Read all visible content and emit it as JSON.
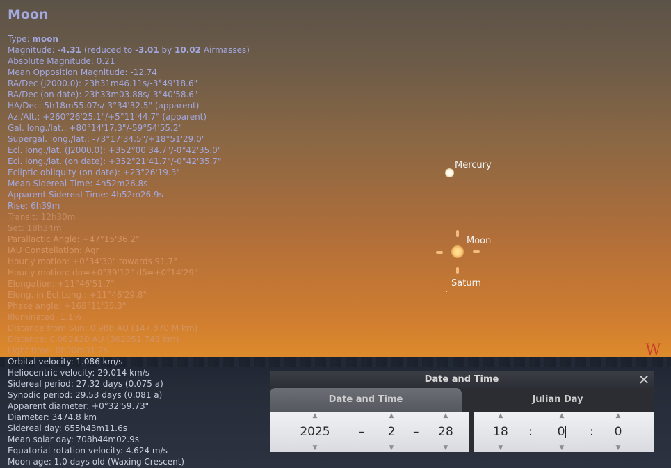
{
  "object": {
    "title": "Moon",
    "lines": [
      {
        "parts": [
          {
            "t": "Type: "
          },
          {
            "t": "moon",
            "b": true
          }
        ],
        "tone": "normal"
      },
      {
        "parts": [
          {
            "t": "Magnitude: "
          },
          {
            "t": "-4.31",
            "b": true
          },
          {
            "t": " (reduced to "
          },
          {
            "t": "-3.01",
            "b": true
          },
          {
            "t": " by "
          },
          {
            "t": "10.02",
            "b": true
          },
          {
            "t": " Airmasses)"
          }
        ],
        "tone": "normal"
      },
      {
        "parts": [
          {
            "t": "Absolute Magnitude: 0.21"
          }
        ],
        "tone": "normal"
      },
      {
        "parts": [
          {
            "t": "Mean Opposition Magnitude: -12.74"
          }
        ],
        "tone": "normal"
      },
      {
        "parts": [
          {
            "t": "RA/Dec (J2000.0): 23h31m46.11s/-3°49'18.6\""
          }
        ],
        "tone": "normal"
      },
      {
        "parts": [
          {
            "t": "RA/Dec (on date): 23h33m03.88s/-3°40'58.6\""
          }
        ],
        "tone": "normal"
      },
      {
        "parts": [
          {
            "t": "HA/Dec: 5h18m55.07s/-3°34'32.5\" (apparent)"
          }
        ],
        "tone": "normal"
      },
      {
        "parts": [
          {
            "t": "Az./Alt.: +260°26'25.1\"/+5°11'44.7\" (apparent)"
          }
        ],
        "tone": "normal"
      },
      {
        "parts": [
          {
            "t": "Gal. long./lat.: +80°14'17.3\"/-59°54'55.2\""
          }
        ],
        "tone": "normal"
      },
      {
        "parts": [
          {
            "t": "Supergal. long./lat.: -73°17'34.5\"/+18°51'29.0\""
          }
        ],
        "tone": "normal"
      },
      {
        "parts": [
          {
            "t": "Ecl. long./lat. (J2000.0): +352°00'34.7\"/-0°42'35.0\""
          }
        ],
        "tone": "normal"
      },
      {
        "parts": [
          {
            "t": "Ecl. long./lat. (on date): +352°21'41.7\"/-0°42'35.7\""
          }
        ],
        "tone": "normal"
      },
      {
        "parts": [
          {
            "t": "Ecliptic obliquity (on date): +23°26'19.3\""
          }
        ],
        "tone": "normal"
      },
      {
        "parts": [
          {
            "t": "Mean Sidereal Time: 4h52m26.8s"
          }
        ],
        "tone": "normal"
      },
      {
        "parts": [
          {
            "t": "Apparent Sidereal Time: 4h52m26.9s"
          }
        ],
        "tone": "normal"
      },
      {
        "parts": [
          {
            "t": "Rise: 6h39m"
          }
        ],
        "tone": "normal"
      },
      {
        "parts": [
          {
            "t": "Transit: 12h30m"
          }
        ],
        "tone": "dim"
      },
      {
        "parts": [
          {
            "t": "Set: 18h34m"
          }
        ],
        "tone": "dim"
      },
      {
        "parts": [
          {
            "t": "Parallactic Angle: +47°15'36.2\""
          }
        ],
        "tone": "faint"
      },
      {
        "parts": [
          {
            "t": "IAU Constellation: Aqr"
          }
        ],
        "tone": "faint"
      },
      {
        "parts": [
          {
            "t": "Hourly motion: +0°34'30\" towards 91.7°"
          }
        ],
        "tone": "faint"
      },
      {
        "parts": [
          {
            "t": "Hourly motion: dα=+0°39'12\" dδ=+0°14'29\""
          }
        ],
        "tone": "faint"
      },
      {
        "parts": [
          {
            "t": "Elongation: +11°46'51.7\""
          }
        ],
        "tone": "faint"
      },
      {
        "parts": [
          {
            "t": "Elong. in Ecl.Long.: +11°46'29.8\""
          }
        ],
        "tone": "faint"
      },
      {
        "parts": [
          {
            "t": "Phase angle: +168°11'35.3\""
          }
        ],
        "tone": "faint"
      },
      {
        "parts": [
          {
            "t": "Illuminated: 1.1%"
          }
        ],
        "tone": "faint"
      },
      {
        "parts": [
          {
            "t": "Distance from Sun: 0.988 AU (147.870 M km)"
          }
        ],
        "tone": "faint"
      },
      {
        "parts": [
          {
            "t": "Distance: 0.002420 AU (362051.746 km)"
          }
        ],
        "tone": "faint"
      },
      {
        "parts": [
          {
            "t": "Light time: 0h00m01.2s"
          }
        ],
        "tone": "faint"
      },
      {
        "parts": [
          {
            "t": "Orbital velocity: 1.086 km/s"
          }
        ],
        "tone": "low"
      },
      {
        "parts": [
          {
            "t": "Heliocentric velocity: 29.014 km/s"
          }
        ],
        "tone": "low"
      },
      {
        "parts": [
          {
            "t": "Sidereal period: 27.32 days (0.075 a)"
          }
        ],
        "tone": "low"
      },
      {
        "parts": [
          {
            "t": "Synodic period: 29.53 days (0.081 a)"
          }
        ],
        "tone": "low"
      },
      {
        "parts": [
          {
            "t": "Apparent diameter: +0°32'59.73\""
          }
        ],
        "tone": "low"
      },
      {
        "parts": [
          {
            "t": "Diameter: 3474.8 km"
          }
        ],
        "tone": "low"
      },
      {
        "parts": [
          {
            "t": "Sidereal day: 655h43m11.6s"
          }
        ],
        "tone": "low"
      },
      {
        "parts": [
          {
            "t": "Mean solar day: 708h44m02.9s"
          }
        ],
        "tone": "low"
      },
      {
        "parts": [
          {
            "t": "Equatorial rotation velocity: 4.624 m/s"
          }
        ],
        "tone": "low"
      },
      {
        "parts": [
          {
            "t": "Moon age: 1.0 days old (Waxing Crescent)"
          }
        ],
        "tone": "low"
      }
    ]
  },
  "sky": {
    "labels": {
      "mercury": "Mercury",
      "moon": "Moon",
      "saturn": "Saturn"
    },
    "compass_west": "W",
    "colors": {
      "label": "#f2f2f2",
      "info_text": "#a3a8df",
      "compass": "#c8402a"
    }
  },
  "dialog": {
    "title": "Date and Time",
    "close_icon": "close-icon",
    "tabs": [
      {
        "label": "Date and Time",
        "active": true
      },
      {
        "label": "Julian Day",
        "active": false
      }
    ],
    "date": {
      "year": "2025",
      "month": "2",
      "day": "28",
      "sep1": "–",
      "sep2": "–"
    },
    "time": {
      "hour": "18",
      "minute": "0",
      "second": "0",
      "sep1": ":",
      "sep2": ":"
    }
  }
}
